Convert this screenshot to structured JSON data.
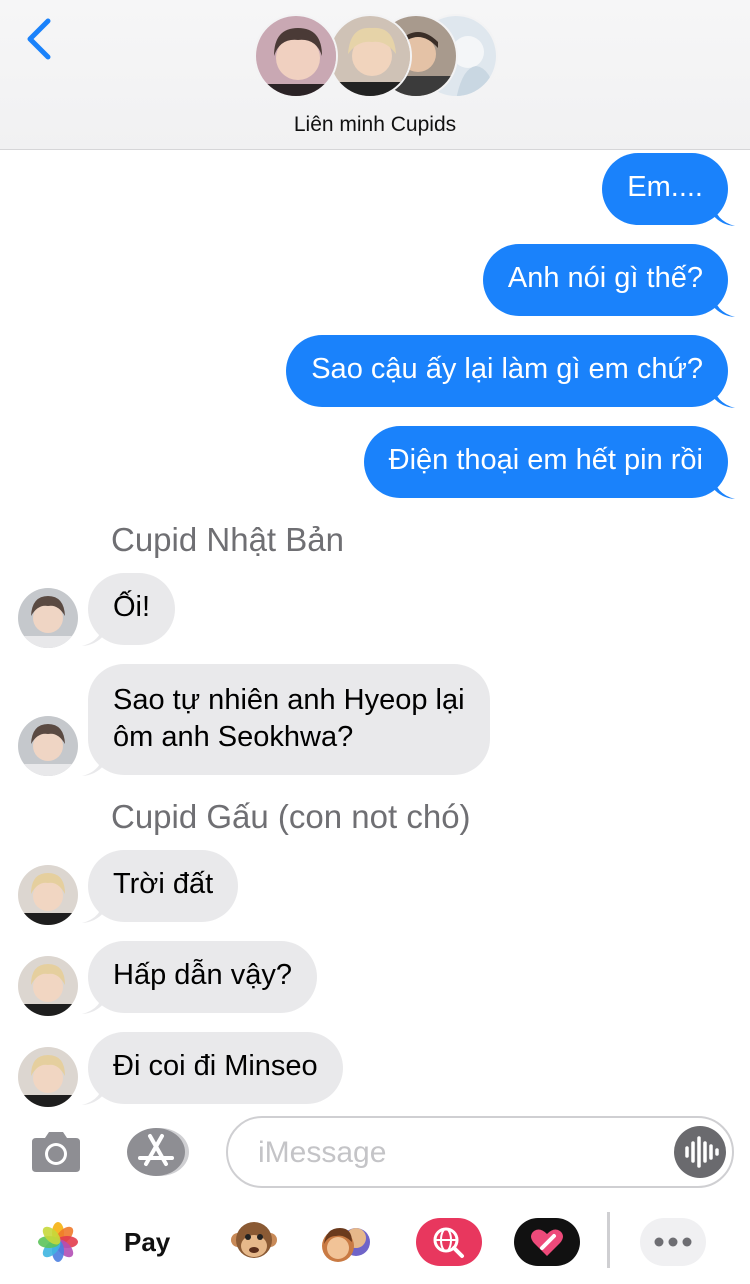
{
  "header": {
    "back_icon": "chevron-left-icon",
    "group_name": "Liên minh Cupids",
    "avatar_count": 4,
    "accent_color": "#1a82fb"
  },
  "messages": [
    {
      "direction": "outgoing",
      "text": "Em...."
    },
    {
      "direction": "outgoing",
      "text": "Anh nói gì thế?"
    },
    {
      "direction": "outgoing",
      "text": "Sao cậu ấy lại làm gì em chứ?"
    },
    {
      "direction": "outgoing",
      "text": "Điện thoại em hết pin rồi"
    },
    {
      "direction": "incoming",
      "sender": "Cupid Nhật Bản",
      "text": "Ối!"
    },
    {
      "direction": "incoming",
      "line1": "Sao tự nhiên anh Hyeop lại",
      "line2": "ôm anh Seokhwa?"
    },
    {
      "direction": "incoming",
      "sender": "Cupid Gấu (con not chó)",
      "text": "Trời đất"
    },
    {
      "direction": "incoming",
      "text": "Hấp dẫn vậy?"
    },
    {
      "direction": "incoming",
      "text": "Đi coi đi Minseo"
    }
  ],
  "composer": {
    "camera_icon": "camera-icon",
    "apps_icon": "app-store-icon",
    "placeholder": "iMessage",
    "audio_icon": "waveform-icon"
  },
  "app_strip": {
    "items": [
      "photos-icon",
      "Pay",
      "animoji-monkey-icon",
      "memoji-icon",
      "web-search-icon",
      "digital-touch-icon",
      "more-icon"
    ]
  }
}
